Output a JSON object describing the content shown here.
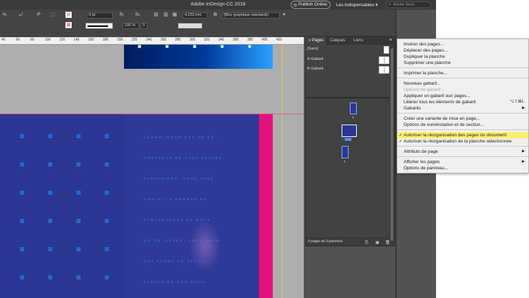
{
  "window": {
    "title": "Adobe InDesign CC 2018"
  },
  "titlebar": {
    "publish_label": "Publish Online",
    "workspace_label": "Les indispensables",
    "search_placeholder": "Adobe Stock"
  },
  "control_bar": {
    "stroke_weight": "0 pt",
    "scale_percent": "100 %",
    "ref_value": "3",
    "gutter_value": "4,233 mm",
    "object_style": "[Bloc graphique standard]+"
  },
  "ruler": {
    "ticks": [
      "40",
      "60",
      "80",
      "100",
      "120",
      "140",
      "160",
      "180",
      "200",
      "220",
      "240",
      "260",
      "280",
      "300",
      "320",
      "340",
      "360",
      "380",
      "400",
      "420"
    ]
  },
  "document": {
    "text_lines": [
      "LOREM IPSUM EST UN GÉ-",
      "NÉRATEUR DE FAUX TEXTES",
      "ALÉATOIRES. VOUS AVEZ",
      "CHOISI LE NOMBRE DE",
      "PARAGRAPHES DE MOTS",
      "OU DE LISTES. VOUS OBTE-",
      "NEZ ALORS UN TEXTE",
      "ALÉATOIRE QUE VOUS"
    ],
    "colors": {
      "page": "#2b3693",
      "accent": "#e5127d",
      "text": "#3f88e8"
    }
  },
  "pages_panel": {
    "tabs": [
      "Pages",
      "Calques",
      "Liens"
    ],
    "masters": [
      "[Sans]",
      "A-Gabarit",
      "B-Gabarit"
    ],
    "page_labels": [
      "1",
      "2-3",
      "4"
    ],
    "footer": "4 pages de 3 planches"
  },
  "menu": {
    "items": [
      {
        "label": "Insérer des pages..."
      },
      {
        "label": "Déplacer des pages..."
      },
      {
        "label": "Dupliquer la planche"
      },
      {
        "label": "Supprimer une planche"
      },
      {
        "label": "Imprimer la planche..."
      },
      {
        "label": "Nouveau gabarit..."
      },
      {
        "label": "Options de gabarit..."
      },
      {
        "label": "Appliquer un gabarit aux pages..."
      },
      {
        "label": "Libérer tous les éléments de gabarit",
        "shortcut": "⌥⇧⌘L"
      },
      {
        "label": "Gabarits"
      },
      {
        "label": "Créer une variante de mise en page..."
      },
      {
        "label": "Options de numérotation et de section..."
      },
      {
        "label": "Autoriser la réorganisation des pages du document"
      },
      {
        "label": "Autoriser la réorganisation de la planche sélectionnée"
      },
      {
        "label": "Attributs de page"
      },
      {
        "label": "Afficher les pages"
      },
      {
        "label": "Options de panneau..."
      }
    ]
  }
}
